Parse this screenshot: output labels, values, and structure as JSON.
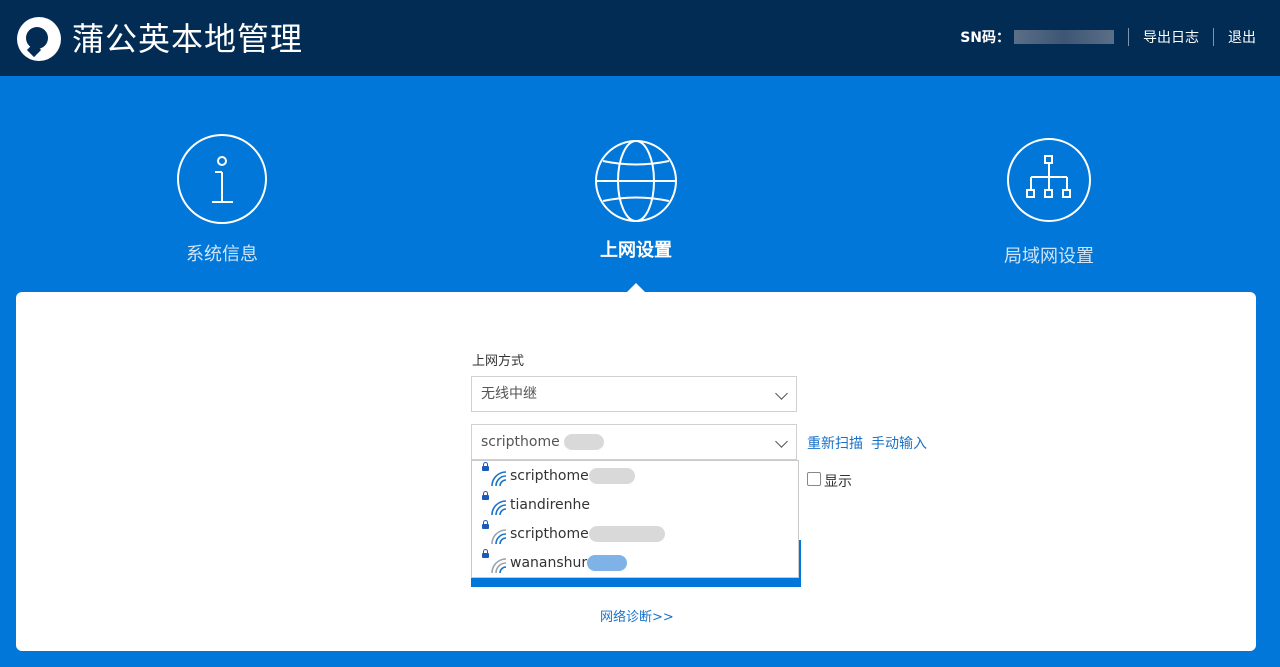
{
  "header": {
    "app_title": "蒲公英本地管理",
    "sn_label": "SN码：",
    "export_log": "导出日志",
    "logout": "退出"
  },
  "nav": [
    {
      "label": "系统信息",
      "icon": "info-icon"
    },
    {
      "label": "上网设置",
      "icon": "globe-icon"
    },
    {
      "label": "局域网设置",
      "icon": "network-topology-icon"
    }
  ],
  "form": {
    "mode_label": "上网方式",
    "mode_value": "无线中继",
    "ssid_value": "scripthome",
    "rescan": "重新扫描",
    "manual_input": "手动输入",
    "show_password": "显示",
    "diagnose": "网络诊断>>"
  },
  "wifi_list": [
    {
      "name": "scripthome"
    },
    {
      "name": "tiandirenhe"
    },
    {
      "name": "scripthome"
    },
    {
      "name": "wananshur"
    }
  ],
  "colors": {
    "accent": "#0077d9",
    "topbar": "#032c55"
  }
}
